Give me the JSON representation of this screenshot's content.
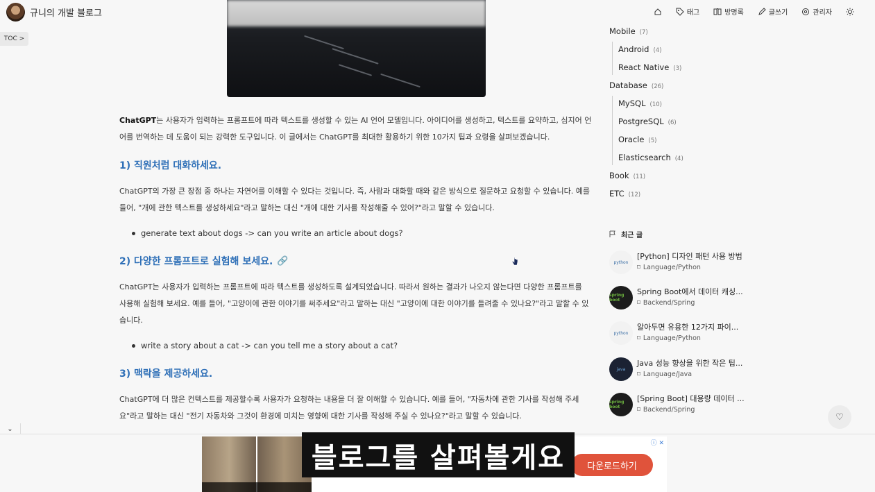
{
  "header": {
    "blog_name": "규니의 개발 블로그",
    "nav": [
      {
        "label": "",
        "icon": "home-icon"
      },
      {
        "label": "태그",
        "icon": "tag-icon"
      },
      {
        "label": "방명록",
        "icon": "book-icon"
      },
      {
        "label": "글쓰기",
        "icon": "pencil-icon"
      },
      {
        "label": "관리자",
        "icon": "gear-icon"
      },
      {
        "label": "",
        "icon": "sun-icon"
      }
    ]
  },
  "toc_label": "TOC >",
  "article": {
    "intro_bold": "ChatGPT",
    "intro_rest_1": "는 사용자가 입력하는 프롬프트에 따라 텍스트를 생성할 수 있는 AI 언어 모델입니다. 아이디어를 생성하고, 텍스트를 요약하고, 심지어 언",
    "intro_rest_2": "어를 번역하는 데 도움이 되는 강력한 도구입니다. 이 글에서는 ChatGPT를 최대한 활용하기 위한 10가지 팁과 요령을 살펴보겠습니다.",
    "sections": [
      {
        "heading": "1) 직원처럼 대화하세요.",
        "body_1": "ChatGPT의 가장 큰 장점 중 하나는 자연어를 이해할 수 있다는 것입니다. 즉, 사람과 대화할 때와 같은 방식으로 질문하고 요청할 수 있습니다. 예를",
        "body_2": "들어, \"개에 관한 텍스트를 생성하세요\"라고 말하는 대신 \"개에 대한 기사를 작성해줄 수 있어?\"라고 말할 수 있습니다.",
        "body_3": "",
        "bullet": "generate text about dogs -> can you write an article about dogs?"
      },
      {
        "heading": "2) 다양한 프롬프트로 실험해 보세요.",
        "body_1": "ChatGPT는 사용자가 입력하는 프롬프트에 따라 텍스트를 생성하도록 설계되었습니다. 따라서 원하는 결과가 나오지 않는다면 다양한 프롬프트를",
        "body_2": "사용해 실험해 보세요. 예를 들어, \"고양이에 관한 이야기를 써주세요\"라고 말하는 대신 \"고양이에 대한 이야기를 들려줄 수 있나요?\"라고 말할 수 있",
        "body_3": "습니다.",
        "bullet": "write a story about a cat -> can you tell me a story about a cat?"
      },
      {
        "heading": "3) 맥락을 제공하세요.",
        "body_1": "ChatGPT에 더 많은 컨텍스트를 제공할수록 사용자가 요청하는 내용을 더 잘 이해할 수 있습니다. 예를 들어, \"자동차에 관한 기사를 작성해 주세",
        "body_2": "요\"라고 말하는 대신 \"전기 자동차와 그것이 환경에 미치는 영향에 대한 기사를 작성해 주실 수 있나요?\"라고 말할 수 있습니다.",
        "body_3": "",
        "bullet": ""
      }
    ]
  },
  "sidebar": {
    "categories": [
      {
        "name": "Mobile",
        "count": "(7)"
      },
      {
        "name": "Android",
        "count": "(4)"
      },
      {
        "name": "React Native",
        "count": "(3)"
      },
      {
        "name": "Database",
        "count": "(26)"
      },
      {
        "name": "MySQL",
        "count": "(10)"
      },
      {
        "name": "PostgreSQL",
        "count": "(6)"
      },
      {
        "name": "Oracle",
        "count": "(5)"
      },
      {
        "name": "Elasticsearch",
        "count": "(4)"
      },
      {
        "name": "Book",
        "count": "(11)"
      },
      {
        "name": "ETC",
        "count": "(12)"
      }
    ],
    "recent_title": "최근 글",
    "recent_posts": [
      {
        "title": "[Python] 디자인 패턴 사용 방법",
        "category": "Language/Python",
        "thumb": "python"
      },
      {
        "title": "Spring Boot에서 데이터 캐싱...",
        "category": "Backend/Spring",
        "thumb": "spring boot"
      },
      {
        "title": "알아두면 유용한 12가지 파이...",
        "category": "Language/Python",
        "thumb": "python"
      },
      {
        "title": "Java 성능 향상을 위한 작은 팁...",
        "category": "Language/Java",
        "thumb": "java"
      },
      {
        "title": "[Spring Boot] 대용량 데이터 ...",
        "category": "Backend/Spring",
        "thumb": "spring boot"
      }
    ]
  },
  "ad": {
    "download_label": "다운로드하기"
  },
  "caption": "블로그를 살펴볼게요"
}
